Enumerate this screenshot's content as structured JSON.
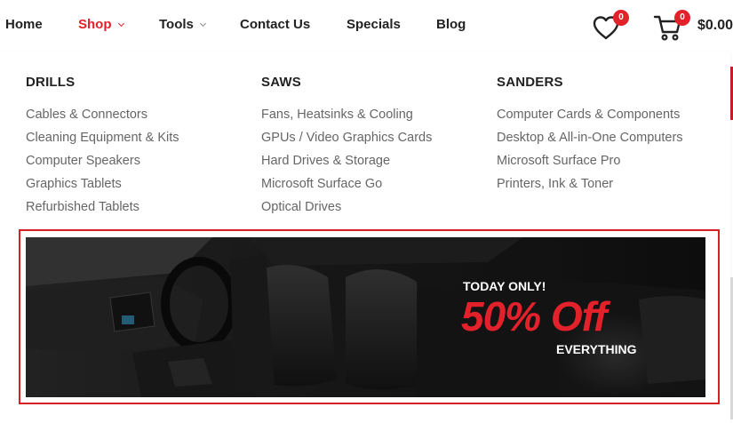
{
  "colors": {
    "accent": "#e3212b",
    "text": "#222222",
    "link": "#666666",
    "banner_border": "#d71f26"
  },
  "nav": {
    "items": [
      {
        "label": "Home"
      },
      {
        "label": "Shop",
        "active": true,
        "has_dropdown": true
      },
      {
        "label": "Tools",
        "has_dropdown": true
      },
      {
        "label": "Contact Us"
      },
      {
        "label": "Specials"
      },
      {
        "label": "Blog"
      }
    ],
    "wishlist": {
      "icon": "heart-icon",
      "count": "0"
    },
    "cart": {
      "icon": "cart-icon",
      "count": "0",
      "total": "$0.00"
    }
  },
  "mega_menu": {
    "columns": [
      {
        "title": "DRILLS",
        "links": [
          "Cables & Connectors",
          "Cleaning Equipment & Kits",
          "Computer Speakers",
          "Graphics Tablets",
          "Refurbished Tablets"
        ]
      },
      {
        "title": "SAWS",
        "links": [
          "Fans, Heatsinks & Cooling",
          "GPUs / Video Graphics Cards",
          "Hard Drives & Storage",
          "Microsoft Surface Go",
          "Optical Drives"
        ]
      },
      {
        "title": "SANDERS",
        "links": [
          "Computer Cards & Components",
          "Desktop & All-in-One Computers",
          "Microsoft Surface Pro",
          "Printers, Ink & Toner"
        ]
      }
    ]
  },
  "promo": {
    "kicker": "TODAY ONLY!",
    "headline": "50% Off",
    "sub": "EVERYTHING"
  }
}
